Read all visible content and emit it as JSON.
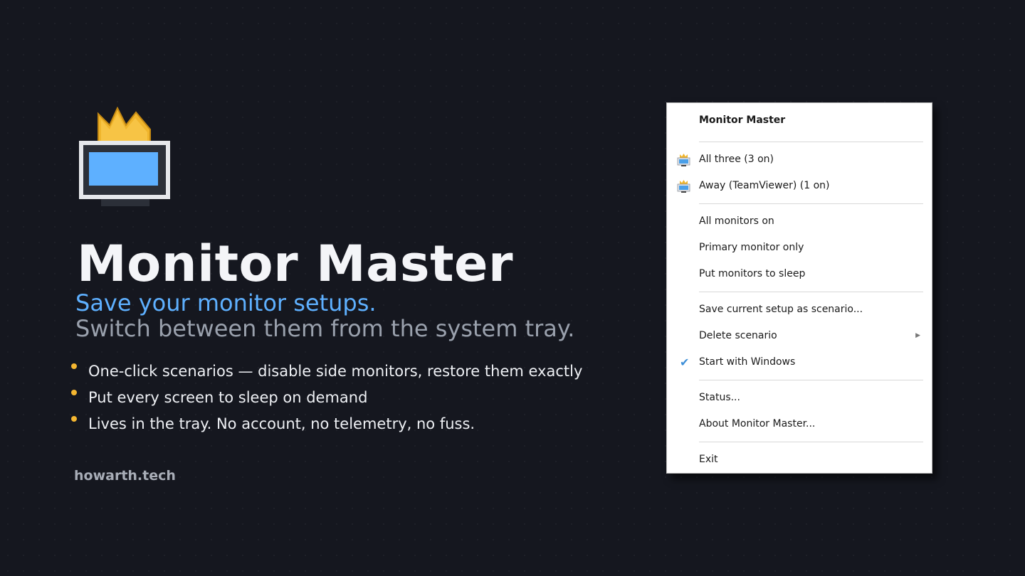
{
  "hero": {
    "title": "Monitor Master",
    "tagline_primary": "Save your monitor setups.",
    "tagline_secondary": "Switch between them from the system tray.",
    "features": [
      "One-click scenarios — disable side monitors, restore them exactly",
      "Put every screen to sleep on demand",
      "Lives in the tray. No account, no telemetry, no fuss."
    ],
    "site": "howarth.tech"
  },
  "menu": {
    "header": "Monitor Master",
    "scenarios": [
      {
        "label": "All three  (3 on)",
        "icon": "monitor-crown-icon"
      },
      {
        "label": "Away (TeamViewer)  (1 on)",
        "icon": "monitor-crown-icon"
      }
    ],
    "actions": [
      "All monitors on",
      "Primary monitor only",
      "Put monitors to sleep"
    ],
    "manage": {
      "save": "Save current setup as scenario...",
      "delete": "Delete scenario",
      "start_with_windows": "Start with Windows",
      "start_with_windows_checked": true
    },
    "info": [
      "Status...",
      "About Monitor Master..."
    ],
    "exit": "Exit"
  },
  "colors": {
    "background": "#15171f",
    "accent_blue": "#5eb0ff",
    "accent_gold": "#f5b731",
    "muted_text": "#9aa1ad"
  }
}
